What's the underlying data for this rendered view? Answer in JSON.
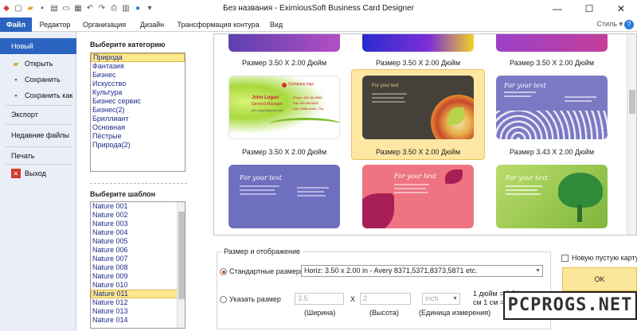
{
  "window": {
    "title": "Без названия - EximiousSoft Business Card Designer",
    "minimize": "—",
    "maximize": "☐",
    "close": "✕"
  },
  "menu": {
    "tabs": [
      "Файл",
      "Редактор",
      "Организация",
      "Дизайн",
      "Трансформация контура",
      "Вид"
    ],
    "style_label": "Стиль ▾",
    "help": "?"
  },
  "nav": {
    "new": "Новый",
    "open": "Открыть",
    "save": "Сохранить",
    "save_as": "Сохранить как",
    "export": "Экспорт",
    "recent": "Недавние файлы",
    "print": "Печать",
    "exit": "Выход"
  },
  "categories": {
    "title": "Выберите категорию",
    "items": [
      "Природа",
      "Фантазия",
      "Бизнес",
      "Искусство",
      "Культура",
      "Бизнес сервис",
      "Бизнес(2)",
      "Бриллиант",
      "Основная",
      "Пёстрые",
      "Природа(2)"
    ],
    "selected": 0
  },
  "templates": {
    "title": "Выберите шаблон",
    "items": [
      "Nature 001",
      "Nature 002",
      "Nature 003",
      "Nature 004",
      "Nature 005",
      "Nature 006",
      "Nature 007",
      "Nature 008",
      "Nature 009",
      "Nature 010",
      "Nature 011",
      "Nature 012",
      "Nature 013",
      "Nature 014"
    ],
    "selected": 10
  },
  "gallery": {
    "row0_captions": [
      "Размер 3.50 X 2.00 Дюйм",
      "Размер 3.50 X 2.00 Дюйм",
      "Размер 3.50 X 2.00 Дюйм"
    ],
    "row1_captions": [
      "Размер 3.50 X 2.00 Дюйм",
      "Размер 3.50 X 2.00 Дюйм",
      "Размер 3.43 X 2.00 Дюйм"
    ],
    "card1": {
      "company": "Company logo",
      "name": "John Logan",
      "role": "General Manager",
      "email": "johnlogan@gmail.com",
      "phone": "Phone: 800-88-8888",
      "fax": "Fax: 800-88-8888",
      "address": "Add: 8888 street, City"
    },
    "card_text": "For your text",
    "colors": {
      "selection": "#fde7a2",
      "purple": "#7b78c4",
      "pink": "#ee7482",
      "green": "#9ccb4f"
    }
  },
  "size_panel": {
    "title": "Размер и отображение",
    "standard_label": "Стандартные размеры",
    "standard_value": "Horiz: 3.50 x 2.00 in - Avery 8371,5371,8373,5871 etc.",
    "custom_label": "Указать размер",
    "width_value": "3.5",
    "height_value": "2",
    "x_sep": "X",
    "unit_value": "inch",
    "width_caption": "(Ширина)",
    "height_caption": "(Высота)",
    "unit_caption": "(Единица измерения)",
    "conv1": "1 дюйм = 2.54",
    "conv2": "см 1 см = 0.39",
    "new_blank": "Новую пустую карту",
    "ok": "OK"
  },
  "watermark": "PCPROGS.NET"
}
